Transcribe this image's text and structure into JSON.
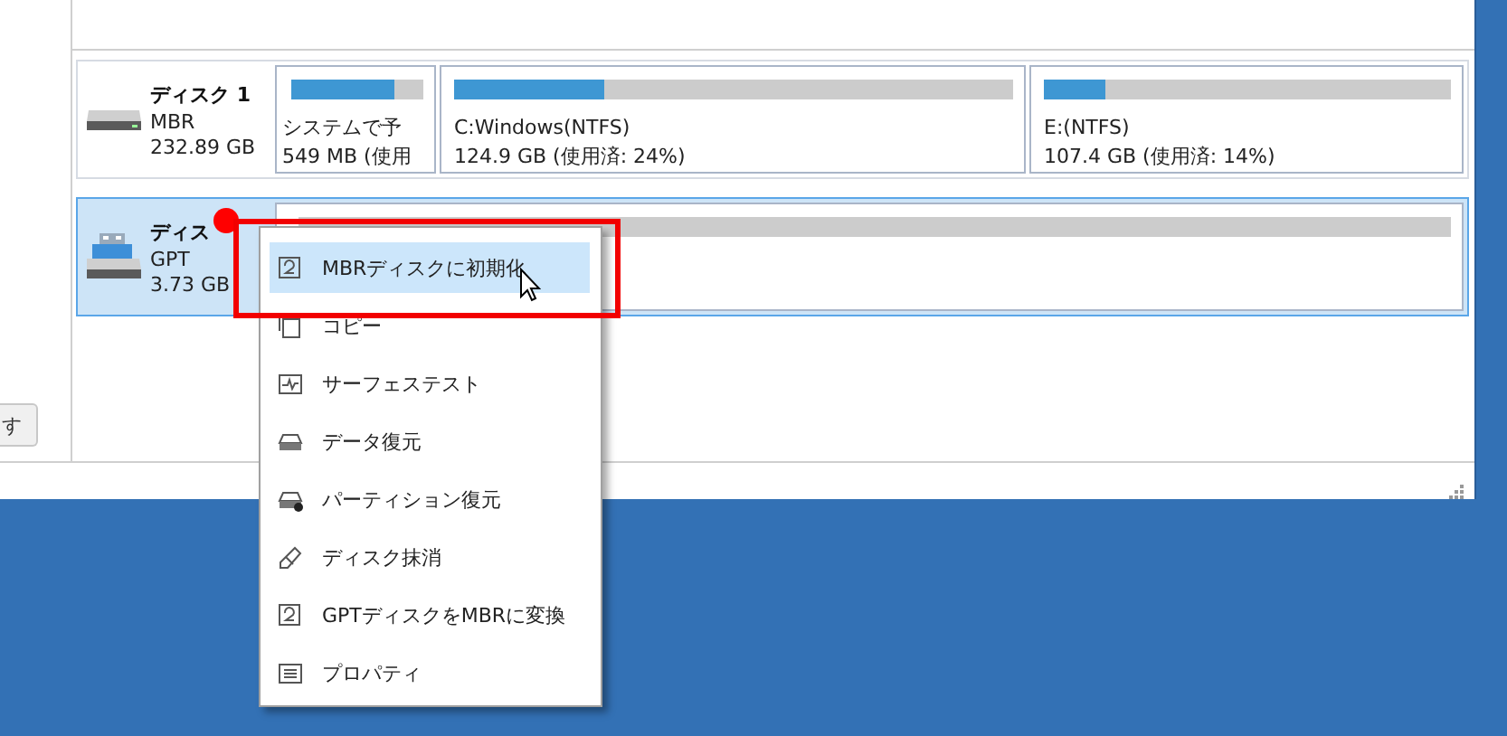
{
  "left_panel": {
    "button": "す"
  },
  "disks": [
    {
      "name": "ディスク 1",
      "scheme": "MBR",
      "size": "232.89 GB",
      "kind": "hdd",
      "selected": false,
      "partitions": [
        {
          "label": "システムで予",
          "usage": "549 MB (使用",
          "level": 0.78
        },
        {
          "label": "C:Windows(NTFS)",
          "usage": "124.9 GB (使用済: 24%)",
          "level": 0.27
        },
        {
          "label": "E:(NTFS)",
          "usage": "107.4 GB (使用済: 14%)",
          "level": 0.15
        }
      ]
    },
    {
      "name": "ディス",
      "scheme": "GPT",
      "size": "3.73 GB",
      "kind": "usb",
      "selected": true,
      "partitions": [
        {
          "level": 0
        }
      ]
    }
  ],
  "context_menu": {
    "items": [
      {
        "label": "MBRディスクに初期化",
        "kind": "init",
        "selected": true
      },
      {
        "label": "コピー",
        "kind": "copy",
        "selected": false
      },
      {
        "label": "サーフェステスト",
        "kind": "surface",
        "selected": false
      },
      {
        "label": "データ復元",
        "kind": "recover",
        "selected": false
      },
      {
        "label": "パーティション復元",
        "kind": "partition",
        "selected": false
      },
      {
        "label": "ディスク抹消",
        "kind": "wipe",
        "selected": false
      },
      {
        "label": "GPTディスクをMBRに変換",
        "kind": "convert",
        "selected": false
      },
      {
        "label": "プロパティ",
        "kind": "props",
        "selected": false
      }
    ]
  }
}
